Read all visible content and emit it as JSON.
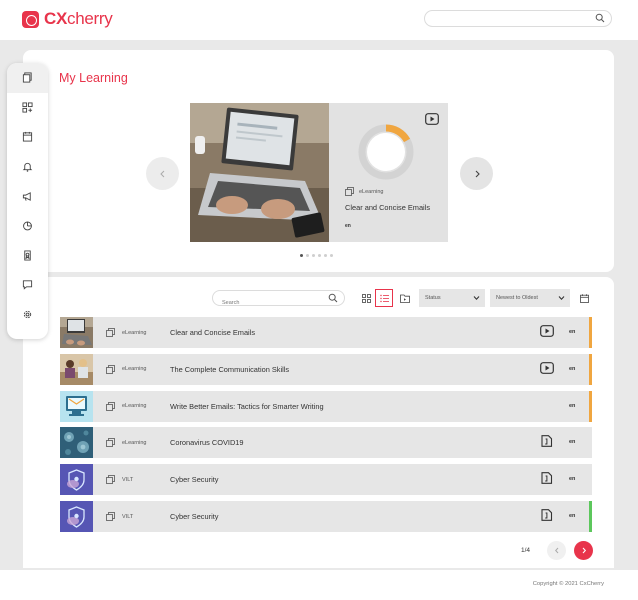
{
  "header": {
    "brand_bold": "CX",
    "brand_rest": "cherry"
  },
  "sidebar": {
    "items": [
      {
        "icon": "courses-icon"
      },
      {
        "icon": "catalog-add-icon"
      },
      {
        "icon": "calendar-icon"
      },
      {
        "icon": "bell-icon"
      },
      {
        "icon": "megaphone-icon"
      },
      {
        "icon": "reports-pie-icon"
      },
      {
        "icon": "certificate-icon"
      },
      {
        "icon": "chat-icon"
      },
      {
        "icon": "settings-icon"
      }
    ]
  },
  "main": {
    "title": "My Learning",
    "featured": {
      "type": "eLearning",
      "title": "Clear and Concise Emails",
      "language": "en",
      "progress": 0.17,
      "action_icon": "play-icon",
      "slide_count": 6,
      "active_slide": 0
    },
    "list": {
      "search_placeholder": "Search",
      "status_label": "Status",
      "sort_label": "Newest to Oldest",
      "view_mode": "list",
      "rows": [
        {
          "type": "eLearning",
          "title": "Clear and Concise Emails",
          "language": "en",
          "action_icon": "play-icon",
          "status_color": "#f0a640",
          "thumb": "laptop"
        },
        {
          "type": "eLearning",
          "title": "The Complete Communication Skills",
          "language": "en",
          "action_icon": "play-icon",
          "status_color": "#f0a640",
          "thumb": "people"
        },
        {
          "type": "eLearning",
          "title": "Write Better Emails: Tactics for Smarter Writing",
          "language": "en",
          "action_icon": "",
          "status_color": "#f0a640",
          "thumb": "email"
        },
        {
          "type": "eLearning",
          "title": "Coronavirus COVID19",
          "language": "en",
          "action_icon": "document-icon",
          "status_color": "",
          "thumb": "virus"
        },
        {
          "type": "VILT",
          "title": "Cyber Security",
          "language": "en",
          "action_icon": "document-icon",
          "status_color": "",
          "thumb": "cyber"
        },
        {
          "type": "VILT",
          "title": "Cyber Security",
          "language": "en",
          "action_icon": "document-icon",
          "status_color": "#5cc75c",
          "thumb": "cyber"
        }
      ]
    },
    "pager": {
      "text": "1/4"
    }
  },
  "footer": {
    "copyright": "Copyright © 2021 CxCherry"
  },
  "colors": {
    "accent": "#e8344b",
    "progress": "#f0a640",
    "complete": "#5cc75c"
  }
}
